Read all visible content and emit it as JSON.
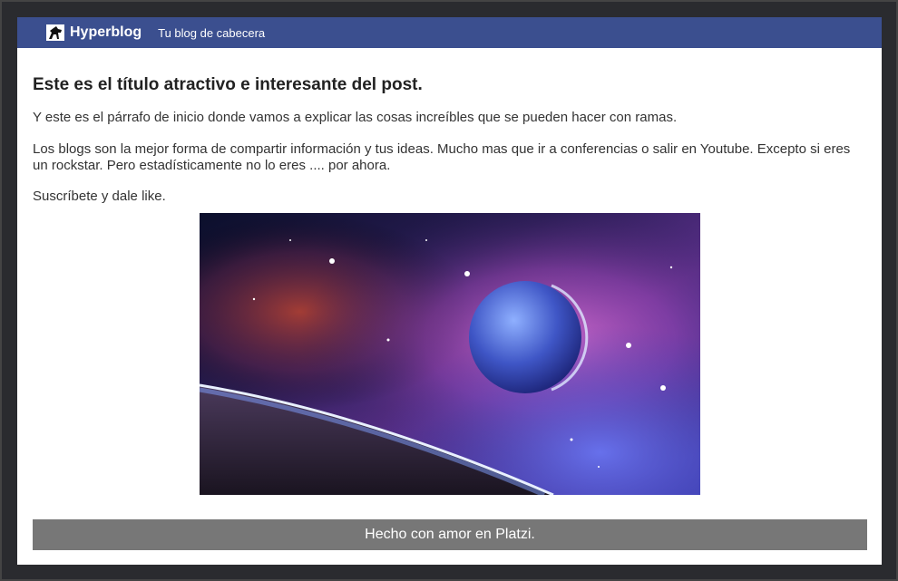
{
  "header": {
    "brand": "Hyperblog",
    "tagline": "Tu blog de cabecera",
    "logo_icon": "horse-logo-icon",
    "color": "#3b4f8f"
  },
  "post": {
    "title": "Este es el título atractivo e interesante del post.",
    "paragraphs": [
      "Y este es el párrafo de inicio donde vamos a explicar las cosas increíbles que se pueden hacer con ramas.",
      "Los blogs son la mejor forma de compartir información y tus ideas. Mucho mas que ir a conferencias o salir en Youtube. Excepto si eres un rockstar. Pero estadísticamente no lo eres .... por ahora.",
      "Suscríbete y dale like."
    ],
    "image": "space-planet-image"
  },
  "footer": {
    "text": "Hecho con amor en Platzi.",
    "color": "#777777"
  }
}
